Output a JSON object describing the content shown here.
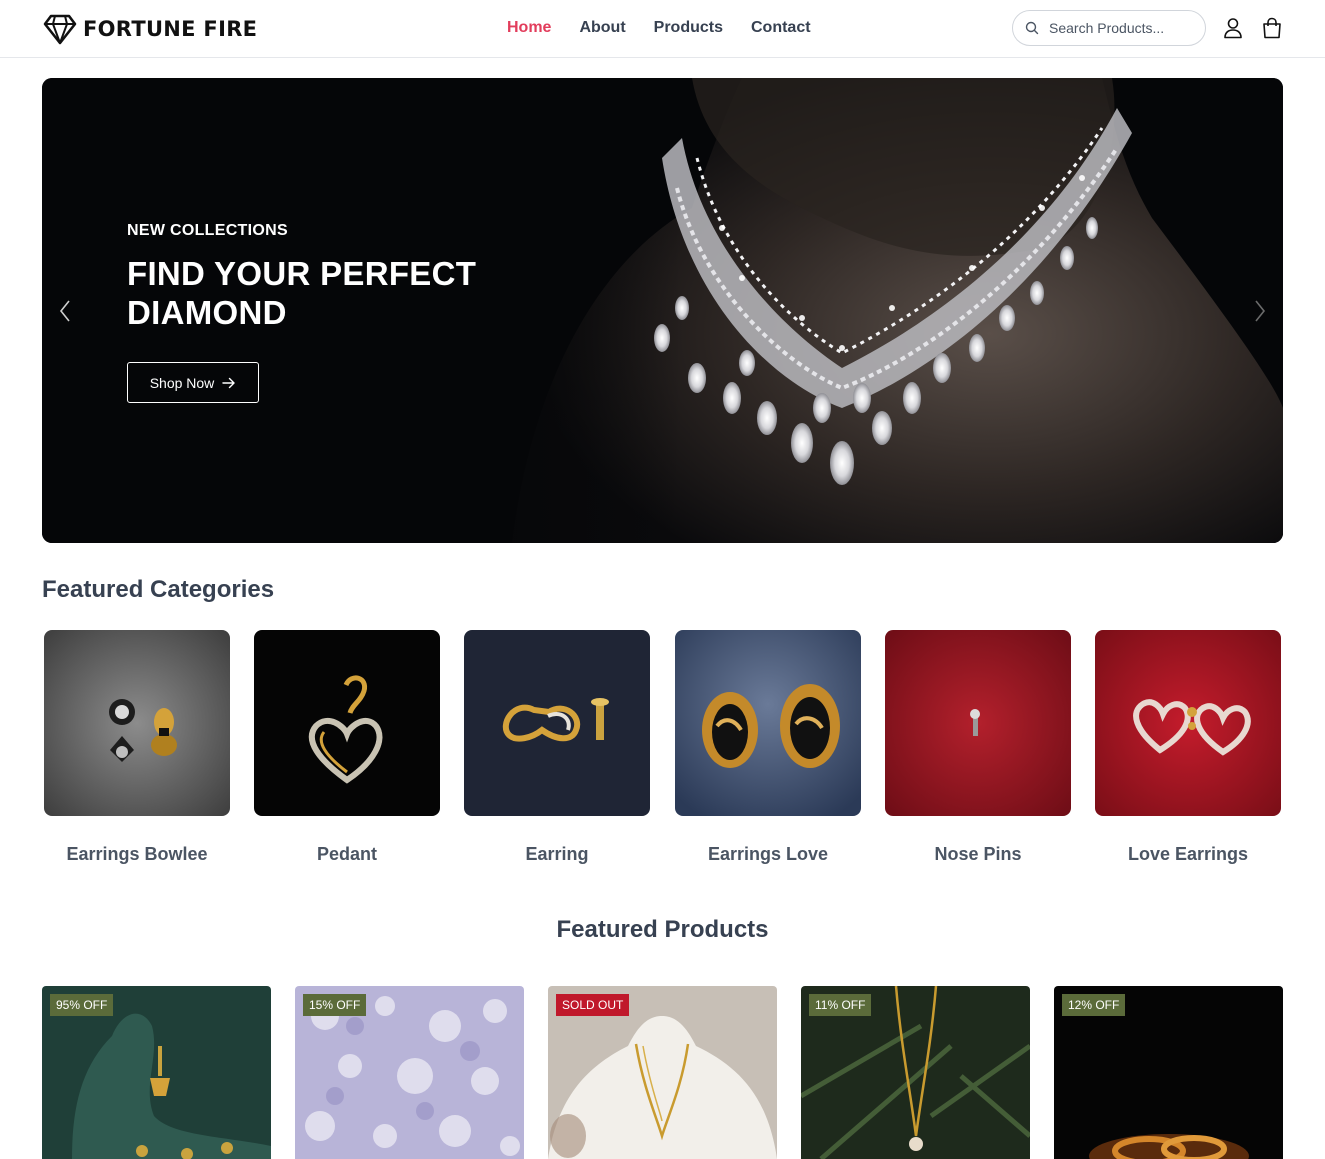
{
  "brand": {
    "name": "FORTUNE FIRE",
    "logo_icon": "diamond-icon"
  },
  "nav": {
    "items": [
      {
        "label": "Home",
        "active": true
      },
      {
        "label": "About",
        "active": false
      },
      {
        "label": "Products",
        "active": false
      },
      {
        "label": "Contact",
        "active": false
      }
    ],
    "accent_color": "#e23d5c"
  },
  "search": {
    "placeholder": "Search Products...",
    "icon": "search-icon"
  },
  "header_icons": [
    "user-icon",
    "shopping-bag-icon"
  ],
  "hero": {
    "eyebrow": "NEW COLLECTIONS",
    "title": "FIND YOUR PERFECT DIAMOND",
    "button_label": "Shop Now",
    "prev_icon": "chevron-left-icon",
    "next_icon": "chevron-right-icon"
  },
  "categories": {
    "title": "Featured Categories",
    "items": [
      {
        "label": "Earrings Bowlee"
      },
      {
        "label": "Pedant"
      },
      {
        "label": "Earring"
      },
      {
        "label": "Earrings Love"
      },
      {
        "label": "Nose Pins"
      },
      {
        "label": "Love Earrings"
      }
    ]
  },
  "products": {
    "title": "Featured Products",
    "items": [
      {
        "badge": "95% OFF",
        "sold_out": false
      },
      {
        "badge": "15% OFF",
        "sold_out": false
      },
      {
        "badge": "SOLD OUT",
        "sold_out": true
      },
      {
        "badge": "11% OFF",
        "sold_out": false
      },
      {
        "badge": "12% OFF",
        "sold_out": false
      }
    ],
    "badge_color": "#5b6b3a",
    "sold_out_color": "#c0182b"
  }
}
